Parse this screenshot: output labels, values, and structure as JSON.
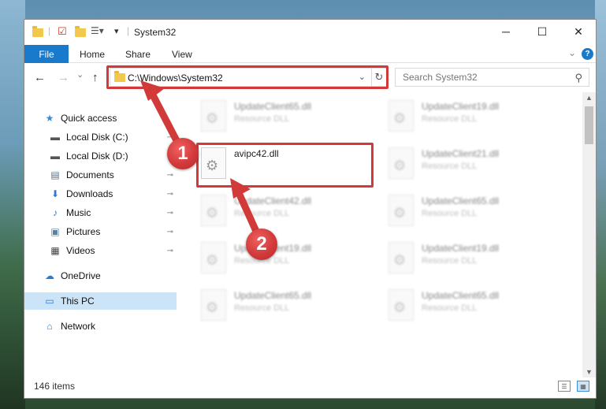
{
  "window": {
    "title": "System32",
    "controls": {
      "minimize": "─",
      "maximize": "☐",
      "close": "✕"
    }
  },
  "ribbon": {
    "tabs": [
      "File",
      "Home",
      "Share",
      "View"
    ],
    "help": "?",
    "expand": "⌄"
  },
  "nav": {
    "back": "←",
    "forward": "→",
    "recent": "⌄",
    "up": "↑",
    "address": "C:\\Windows\\System32",
    "address_dropdown": "⌄",
    "refresh": "↻",
    "search_placeholder": "Search System32",
    "search_icon": "⚲"
  },
  "sidebar": {
    "items": [
      {
        "label": "Quick access",
        "icon": "star-icon",
        "glyph": "★",
        "color": "#3b87d9"
      },
      {
        "label": "Local Disk (C:)",
        "icon": "drive-icon",
        "glyph": "▬",
        "color": "#555555",
        "pinned": true
      },
      {
        "label": "Local Disk (D:)",
        "icon": "drive-icon",
        "glyph": "▬",
        "color": "#555555",
        "pinned": true
      },
      {
        "label": "Documents",
        "icon": "document-icon",
        "glyph": "▤",
        "color": "#5a6d80",
        "pinned": true
      },
      {
        "label": "Downloads",
        "icon": "download-icon",
        "glyph": "⬇",
        "color": "#2a7bd6",
        "pinned": true
      },
      {
        "label": "Music",
        "icon": "music-icon",
        "glyph": "♪",
        "color": "#2a7bd6",
        "pinned": true
      },
      {
        "label": "Pictures",
        "icon": "pictures-icon",
        "glyph": "▣",
        "color": "#5a7fa0",
        "pinned": true
      },
      {
        "label": "Videos",
        "icon": "video-icon",
        "glyph": "▦",
        "color": "#444444",
        "pinned": true
      },
      {
        "label": "OneDrive",
        "icon": "cloud-icon",
        "glyph": "☁",
        "color": "#2a7bd6"
      },
      {
        "label": "This PC",
        "icon": "computer-icon",
        "glyph": "▭",
        "color": "#2a7bd6",
        "selected": true
      },
      {
        "label": "Network",
        "icon": "network-icon",
        "glyph": "⌂",
        "color": "#2a7bd6"
      }
    ],
    "pin_glyph": "📌"
  },
  "files": [
    {
      "name": "UpdateClient65.dll",
      "type": "Resource DLL"
    },
    {
      "name": "UpdateClient19.dll",
      "type": "Resource DLL"
    },
    {
      "name": "avipc42.dll",
      "type": ""
    },
    {
      "name": "UpdateClient21.dll",
      "type": "Resource DLL"
    },
    {
      "name": "UpdateClient42.dll",
      "type": "Resource DLL"
    },
    {
      "name": "UpdateClient65.dll",
      "type": "Resource DLL"
    },
    {
      "name": "UpdateClient19.dll",
      "type": "Resource DLL"
    },
    {
      "name": "UpdateClient19.dll",
      "type": "Resource DLL"
    },
    {
      "name": "UpdateClient65.dll",
      "type": "Resource DLL"
    },
    {
      "name": "UpdateClient65.dll",
      "type": "Resource DLL"
    }
  ],
  "status": {
    "count": "146 items"
  },
  "annotations": {
    "step1": "1",
    "step2": "2",
    "color": "#d23a3a"
  }
}
